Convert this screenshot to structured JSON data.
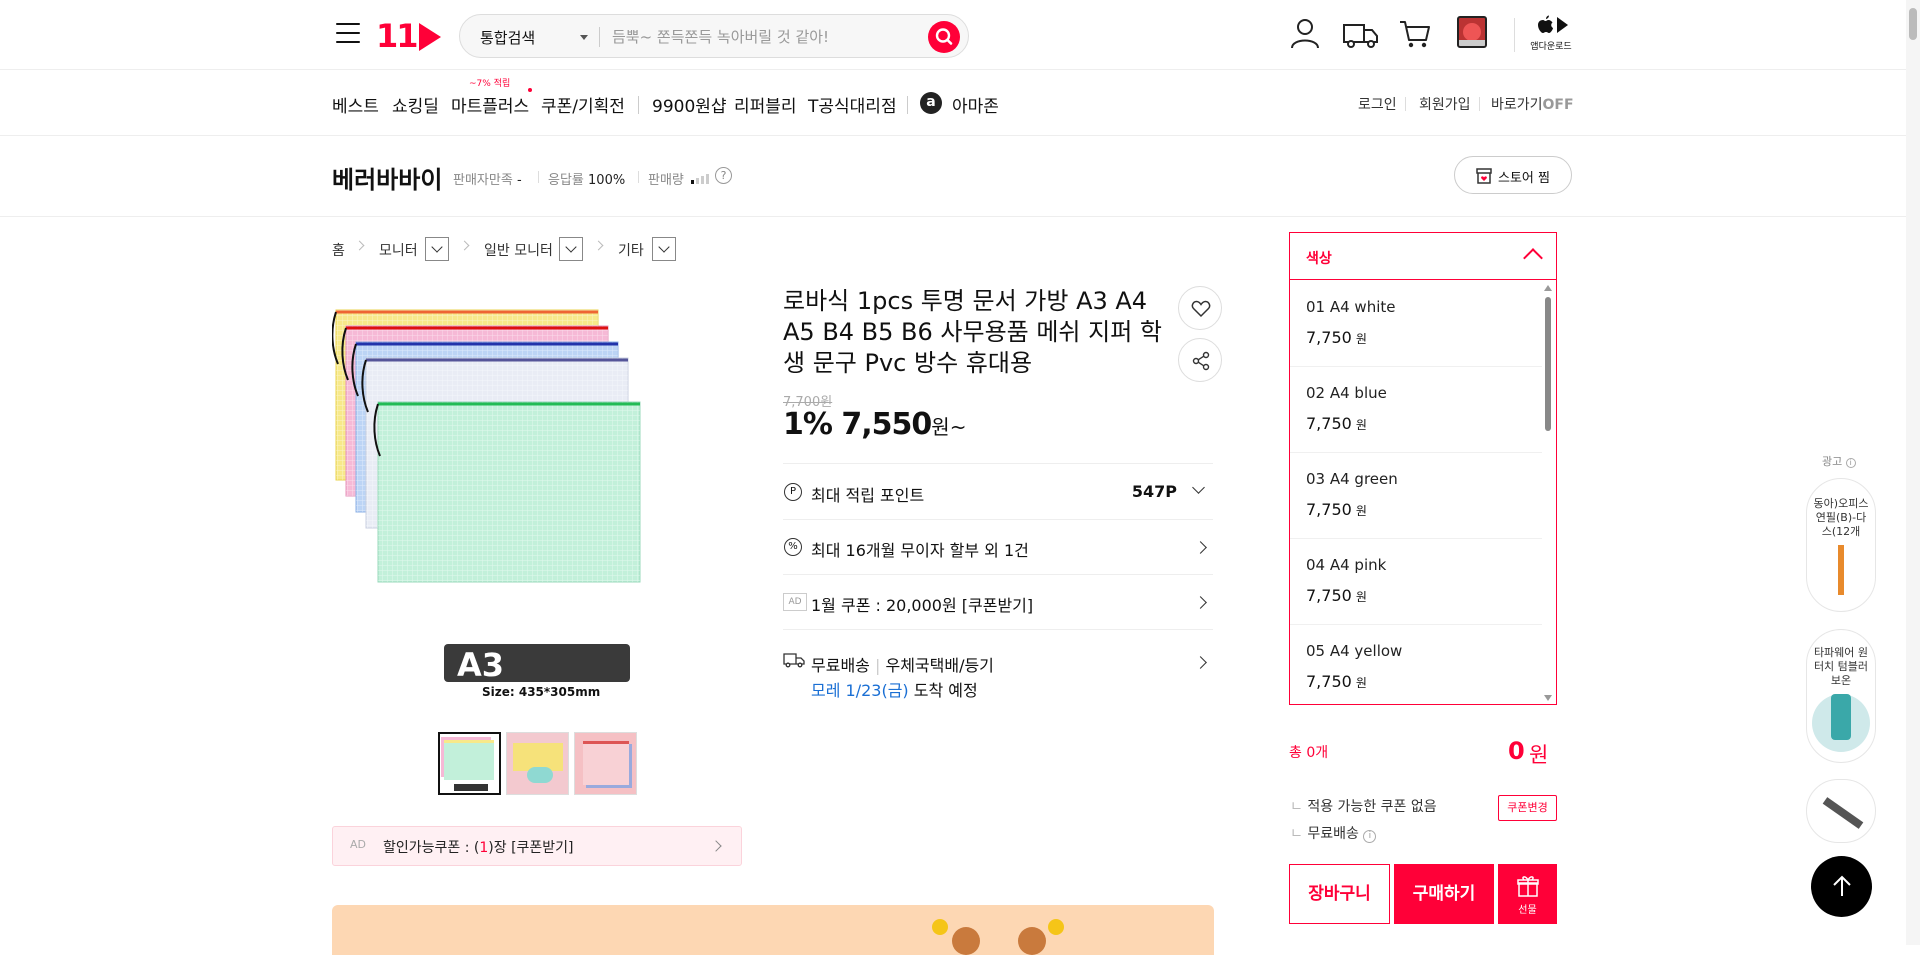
{
  "header": {
    "logo": "11",
    "search_category": "통합검색",
    "search_placeholder": "듬뿍~ 쫀득쫀득 녹아버릴 것 같아!",
    "app_download": "앱다운로드"
  },
  "nav": {
    "items": [
      "베스트",
      "쇼킹딜",
      "마트플러스",
      "쿠폰/기획전",
      "9900원샵",
      "리퍼블리",
      "T공식대리점",
      "아마존"
    ],
    "mart_badge": "~7% 적립",
    "login": "로그인",
    "signup": "회원가입",
    "shortcut": "바로가기",
    "shortcut_state": "OFF"
  },
  "seller": {
    "name": "베러바바이",
    "satisfaction_label": "판매자만족",
    "satisfaction_value": "-",
    "response_label": "응답률",
    "response_value": "100%",
    "sales_label": "판매량",
    "store_button": "스토어 찜"
  },
  "breadcrumb": [
    "홈",
    "모니터",
    "일반 모니터",
    "기타"
  ],
  "product": {
    "image_label": "A3",
    "image_size": "Size: 435*305mm",
    "title": "로바식 1pcs 투명 문서 가방 A3 A4 A5 B4 B5 B6 사무용품 메쉬 지퍼 학생 문구 Pvc 방수 휴대용",
    "original_price": "7,700원",
    "discount": "1%",
    "price": "7,550",
    "price_suffix": "원~",
    "points_label": "최대 적립 포인트",
    "points_value": "547P",
    "installment": "최대 16개월 무이자 할부 외 1건",
    "coupon_ad": "AD",
    "coupon_text": "1월 쿠폰 : 20,000원 [쿠폰받기]",
    "shipping_free": "무료배송",
    "shipping_method": "우체국택배/등기",
    "arrival_date": "모레 1/23(금)",
    "arrival_suffix": "도착 예정",
    "discount_coupon_ad": "AD",
    "discount_coupon_prefix": "할인가능쿠폰 : (",
    "discount_coupon_count": "1",
    "discount_coupon_suffix": ")장 [쿠폰받기]"
  },
  "options": {
    "header": "색상",
    "items": [
      {
        "name": "01 A4 white",
        "price": "7,750",
        "unit": "원"
      },
      {
        "name": "02 A4 blue",
        "price": "7,750",
        "unit": "원"
      },
      {
        "name": "03 A4 green",
        "price": "7,750",
        "unit": "원"
      },
      {
        "name": "04 A4 pink",
        "price": "7,750",
        "unit": "원"
      },
      {
        "name": "05 A4 yellow",
        "price": "7,750",
        "unit": "원"
      }
    ]
  },
  "order": {
    "total_label": "총 0개",
    "total_value": "0",
    "total_unit": "원",
    "no_coupon": "적용 가능한 쿠폰 없음",
    "free_shipping": "무료배송",
    "coupon_change": "쿠폰변경",
    "cart": "장바구니",
    "buy": "구매하기",
    "gift": "선물"
  },
  "rail": {
    "ad_label": "광고",
    "card1": "동아)오피스연필(B)-다스(12개",
    "card2": "타파웨어 원터치 텀블러 보온"
  },
  "colors": {
    "brand": "#ff0038",
    "link_blue": "#1a6fd4"
  }
}
